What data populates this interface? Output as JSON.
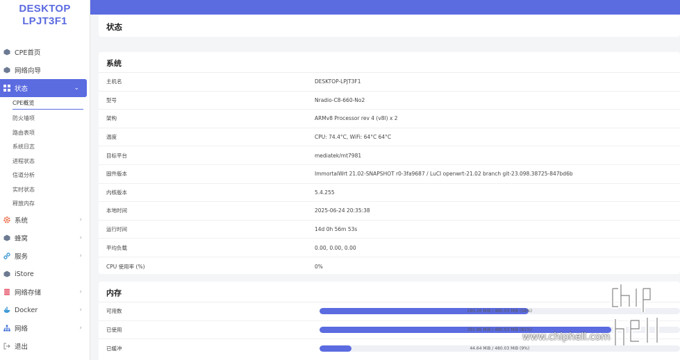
{
  "brand": {
    "line1": "DESKTOP",
    "line2": "LPJT3F1"
  },
  "sidebar": {
    "top_items": [
      {
        "label": "CPE首页",
        "icon": "cube-icon"
      },
      {
        "label": "网络向导",
        "icon": "cube-icon"
      }
    ],
    "active_item": {
      "label": "状态",
      "icon": "grid-icon"
    },
    "sub_items": [
      "CPE概览",
      "防火墙项",
      "路由表项",
      "系统日志",
      "进程状态",
      "信道分析",
      "实时状态",
      "释放内存"
    ],
    "bottom_items": [
      {
        "label": "系统",
        "icon": "gear-icon",
        "has_children": true
      },
      {
        "label": "蜂窝",
        "icon": "cube-icon",
        "has_children": true
      },
      {
        "label": "服务",
        "icon": "link-icon",
        "has_children": true
      },
      {
        "label": "iStore",
        "icon": "cube-icon",
        "has_children": false
      },
      {
        "label": "网络存储",
        "icon": "storage-icon",
        "has_children": true
      },
      {
        "label": "Docker",
        "icon": "docker-icon",
        "has_children": true
      },
      {
        "label": "网络",
        "icon": "network-icon",
        "has_children": true
      },
      {
        "label": "退出",
        "icon": "logout-icon",
        "has_children": false
      }
    ]
  },
  "page": {
    "title": "状态"
  },
  "system": {
    "heading": "系统",
    "rows": [
      {
        "k": "主机名",
        "v": "DESKTOP-LPJT3F1"
      },
      {
        "k": "型号",
        "v": "Nradio-C8-660-No2"
      },
      {
        "k": "架构",
        "v": "ARMv8 Processor rev 4 (v8l) x 2"
      },
      {
        "k": "温度",
        "v": "CPU: 74.4°C, WiFi: 64°C 64°C"
      },
      {
        "k": "目标平台",
        "v": "mediatek/mt7981"
      },
      {
        "k": "固件版本",
        "v": "ImmortalWrt 21.02-SNAPSHOT r0-3fa9687 / LuCI openwrt-21.02 branch git-23.098.38725-847bd6b"
      },
      {
        "k": "内核版本",
        "v": "5.4.255"
      },
      {
        "k": "本地时间",
        "v": "2025-06-24 20:35:38"
      },
      {
        "k": "运行时间",
        "v": "14d 0h 56m 53s"
      },
      {
        "k": "平均负载",
        "v": "0.00, 0.00, 0.00"
      },
      {
        "k": "CPU 使用率 (%)",
        "v": "0%"
      }
    ]
  },
  "memory": {
    "heading": "内存",
    "rows": [
      {
        "k": "可用数",
        "text": "280.26 MiB / 480.03 MiB (58%)",
        "fraction": 0.58
      },
      {
        "k": "已使用",
        "text": "391.96 MiB / 480.03 MiB (81%)",
        "fraction": 0.81
      },
      {
        "k": "已缓冲",
        "text": "44.64 MiB / 480.03 MiB (9%)",
        "fraction": 0.09
      }
    ]
  },
  "watermark": {
    "text": "www.chiphell.com"
  },
  "colors": {
    "accent": "#5b6be0"
  }
}
